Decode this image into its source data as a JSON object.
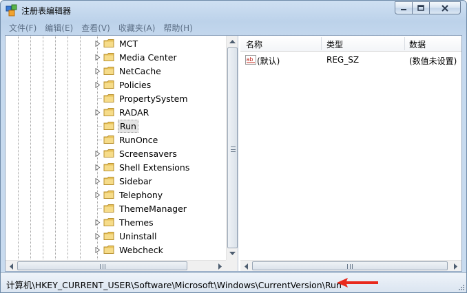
{
  "window": {
    "title": "注册表编辑器",
    "controls": {
      "minimize": "minimize",
      "maximize": "maximize",
      "close": "close"
    }
  },
  "menu": [
    "文件(F)",
    "编辑(E)",
    "查看(V)",
    "收藏夹(A)",
    "帮助(H)"
  ],
  "tree": {
    "nodes": [
      {
        "label": "MCT",
        "expandable": true,
        "selected": false
      },
      {
        "label": "Media Center",
        "expandable": true,
        "selected": false
      },
      {
        "label": "NetCache",
        "expandable": true,
        "selected": false
      },
      {
        "label": "Policies",
        "expandable": true,
        "selected": false
      },
      {
        "label": "PropertySystem",
        "expandable": false,
        "selected": false
      },
      {
        "label": "RADAR",
        "expandable": true,
        "selected": false
      },
      {
        "label": "Run",
        "expandable": false,
        "selected": true
      },
      {
        "label": "RunOnce",
        "expandable": false,
        "selected": false
      },
      {
        "label": "Screensavers",
        "expandable": true,
        "selected": false
      },
      {
        "label": "Shell Extensions",
        "expandable": true,
        "selected": false
      },
      {
        "label": "Sidebar",
        "expandable": true,
        "selected": false
      },
      {
        "label": "Telephony",
        "expandable": true,
        "selected": false
      },
      {
        "label": "ThemeManager",
        "expandable": false,
        "selected": false
      },
      {
        "label": "Themes",
        "expandable": true,
        "selected": false
      },
      {
        "label": "Uninstall",
        "expandable": true,
        "selected": false
      },
      {
        "label": "Webcheck",
        "expandable": true,
        "selected": false
      }
    ]
  },
  "list": {
    "columns": {
      "name": "名称",
      "type": "类型",
      "data": "数据"
    },
    "rows": [
      {
        "name": "(默认)",
        "type": "REG_SZ",
        "data": "(数值未设置)",
        "icon": "string-value-icon"
      }
    ]
  },
  "status": {
    "path": "计算机\\HKEY_CURRENT_USER\\Software\\Microsoft\\Windows\\CurrentVersion\\Run"
  },
  "colors": {
    "accent_arrow": "#e8291c",
    "folder": "#e8c25a",
    "selection": "#e4e4e4"
  }
}
